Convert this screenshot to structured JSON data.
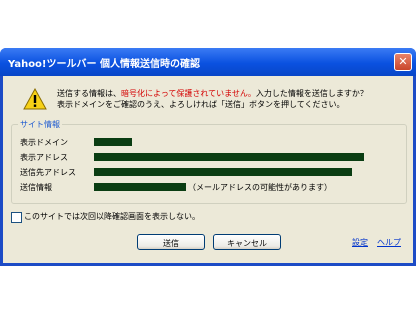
{
  "window": {
    "title": "Yahoo!ツールバー  個人情報送信時の確認",
    "close_label": "✕"
  },
  "message": {
    "line1_prefix": "送信する情報は、",
    "line1_red": "暗号化によって保護されていません。",
    "line1_suffix": "入力した情報を送信しますか？",
    "line2": "表示ドメインをご確認のうえ、よろしければ「送信」ボタンを押してください。"
  },
  "site_info": {
    "group_title": "サイト情報",
    "rows": [
      {
        "label": "表示ドメイン"
      },
      {
        "label": "表示アドレス"
      },
      {
        "label": "送信先アドレス"
      },
      {
        "label": "送信情報",
        "note": "（メールアドレスの可能性があります）"
      }
    ]
  },
  "checkbox": {
    "label": "このサイトでは次回以降確認画面を表示しない。",
    "checked": false
  },
  "buttons": {
    "send": "送信",
    "cancel": "キャンセル"
  },
  "links": {
    "settings": "設定",
    "help": "ヘルプ"
  },
  "colors": {
    "titlebar": "#0a51e0",
    "redaction": "#0a3d12",
    "warning_text": "#d40000",
    "client_bg": "#ece9d8"
  },
  "icons": {
    "warning": "warning-icon",
    "close": "close-icon"
  }
}
